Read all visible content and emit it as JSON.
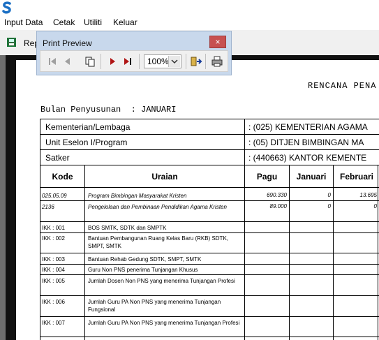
{
  "menu": [
    "Input Data",
    "Cetak",
    "Utiliti",
    "Keluar"
  ],
  "toolbar": {
    "rep_label": "Rep"
  },
  "print_preview": {
    "title": "Print Preview",
    "close_label": "×",
    "zoom": "100%"
  },
  "report": {
    "title": "RENCANA PENA",
    "bulan_label": "Bulan Penyusunan  : JANUARI",
    "header_rows": [
      {
        "label": "Kementerian/Lembaga",
        "value": ": (025)  KEMENTERIAN AGAMA"
      },
      {
        "label": "Unit Eselon I/Program",
        "value": ": (05)  DITJEN BIMBINGAN MA"
      },
      {
        "label": "Satker",
        "value": ": (440663)  KANTOR KEMENTE"
      }
    ],
    "columns": [
      "Kode",
      "Uraian",
      "Pagu",
      "Januari",
      "Februari"
    ],
    "rows": [
      {
        "kode": "025.05.09",
        "uraian": "Program Bimbingan Masyarakat Kristen",
        "pagu": "690.330",
        "jan": "0",
        "feb": "13.695"
      },
      {
        "kode": "2136",
        "uraian": "Pengelolaan dan Pembinaan Pendidikan Agama Kristen",
        "pagu": "89.000",
        "jan": "0",
        "feb": "0"
      },
      {
        "kode": "IKK : 001",
        "uraian": "BOS SMTK, SDTK dan SMPTK",
        "pagu": "",
        "jan": "",
        "feb": ""
      },
      {
        "kode": "IKK : 002",
        "uraian": "Bantuan Pembangunan Ruang Kelas Baru (RKB) SDTK, SMPT, SMTK",
        "pagu": "",
        "jan": "",
        "feb": ""
      },
      {
        "kode": "IKK : 003",
        "uraian": "Bantuan Rehab Gedung SDTK, SMPT, SMTK",
        "pagu": "",
        "jan": "",
        "feb": ""
      },
      {
        "kode": "IKK : 004",
        "uraian": "Guru Non PNS penerima Tunjangan Khusus",
        "pagu": "",
        "jan": "",
        "feb": ""
      },
      {
        "kode": "IKK : 005",
        "uraian": "Jumlah Dosen Non PNS yang menerima Tunjangan Profesi",
        "pagu": "",
        "jan": "",
        "feb": ""
      },
      {
        "kode": "IKK : 006",
        "uraian": "Jumlah Guru PA Non PNS yang menerima Tunjangan Fungsional",
        "pagu": "",
        "jan": "",
        "feb": ""
      },
      {
        "kode": "IKK : 007",
        "uraian": "Jumlah Guru PA Non PNS yang menerima Tunjangan Profesi",
        "pagu": "",
        "jan": "",
        "feb": ""
      }
    ]
  },
  "icons": [
    "app-icon",
    "report-icon",
    "first-page-icon",
    "prev-page-icon",
    "multi-page-icon",
    "next-page-icon",
    "last-page-icon",
    "exit-preview-icon",
    "print-icon",
    "close-icon"
  ]
}
